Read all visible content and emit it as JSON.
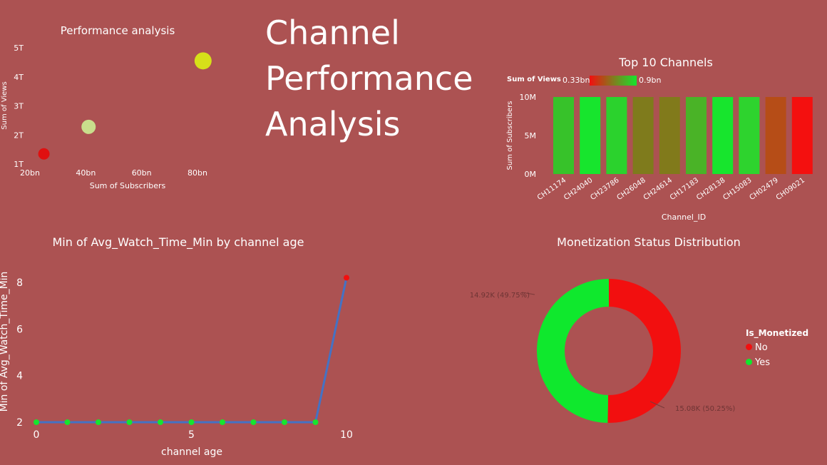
{
  "dashboard": {
    "title_lines": [
      "Channel",
      "Performance",
      "Analysis"
    ],
    "background": "#ac5252"
  },
  "chart_data": [
    {
      "id": "scatter",
      "type": "scatter",
      "title": "Performance analysis",
      "xlabel": "Sum of Subscribers",
      "ylabel": "Sum of Views",
      "x_ticks": [
        "20bn",
        "40bn",
        "60bn",
        "80bn"
      ],
      "y_ticks": [
        "1T",
        "2T",
        "3T",
        "4T",
        "5T"
      ],
      "xlim": [
        20,
        80
      ],
      "ylim": [
        1,
        5
      ],
      "points": [
        {
          "x": 25,
          "y": 1.35,
          "color": "#e01010",
          "size": 8
        },
        {
          "x": 41,
          "y": 2.28,
          "color": "#c9de8c",
          "size": 10
        },
        {
          "x": 82,
          "y": 4.55,
          "color": "#d6e019",
          "size": 12
        }
      ]
    },
    {
      "id": "bars",
      "type": "bar",
      "title": "Top 10 Channels",
      "xlabel": "Channel_ID",
      "ylabel": "Sum of Subscribers",
      "y_ticks": [
        "0M",
        "5M",
        "10M"
      ],
      "ylim": [
        0,
        10
      ],
      "legend": {
        "label": "Sum of Views",
        "min": "0.33bn",
        "max": "0.9bn"
      },
      "categories": [
        "CH11174",
        "CH24040",
        "CH23786",
        "CH26048",
        "CH24614",
        "CH17183",
        "CH28138",
        "CH15083",
        "CH02479",
        "CH09021"
      ],
      "values": [
        10,
        10,
        10,
        10,
        10,
        10,
        10,
        10,
        10,
        10
      ],
      "colors": [
        "#37c22a",
        "#17e52d",
        "#2bd22d",
        "#7f7b1c",
        "#817a1b",
        "#4ab327",
        "#17e52d",
        "#2ed32e",
        "#b64d17",
        "#f4100f"
      ]
    },
    {
      "id": "line",
      "type": "line",
      "title": "Min of Avg_Watch_Time_Min by channel age",
      "xlabel": "channel age",
      "ylabel": "Min of Avg_Watch_Time_Min",
      "x_ticks": [
        "0",
        "5",
        "10"
      ],
      "y_ticks": [
        "2",
        "4",
        "6",
        "8"
      ],
      "xlim": [
        0,
        10
      ],
      "ylim": [
        2,
        8
      ],
      "x": [
        0,
        1,
        2,
        3,
        4,
        5,
        6,
        7,
        8,
        9,
        10
      ],
      "y": [
        2,
        2,
        2,
        2,
        2,
        2,
        2,
        2,
        2,
        2,
        8.2
      ],
      "line_color": "#4472c4",
      "point_colors": [
        "#17e52d",
        "#17e52d",
        "#17e52d",
        "#17e52d",
        "#17e52d",
        "#17e52d",
        "#17e52d",
        "#17e52d",
        "#17e52d",
        "#17e52d",
        "#f20f0f"
      ]
    },
    {
      "id": "donut",
      "type": "pie",
      "title": "Monetization Status Distribution",
      "legend_title": "Is_Monetized",
      "slices": [
        {
          "label": "No",
          "value": 50.25,
          "display": "15.08K (50.25%)",
          "color": "#f20f0f"
        },
        {
          "label": "Yes",
          "value": 49.75,
          "display": "14.92K (49.75%)",
          "color": "#0fe82d"
        }
      ]
    }
  ]
}
